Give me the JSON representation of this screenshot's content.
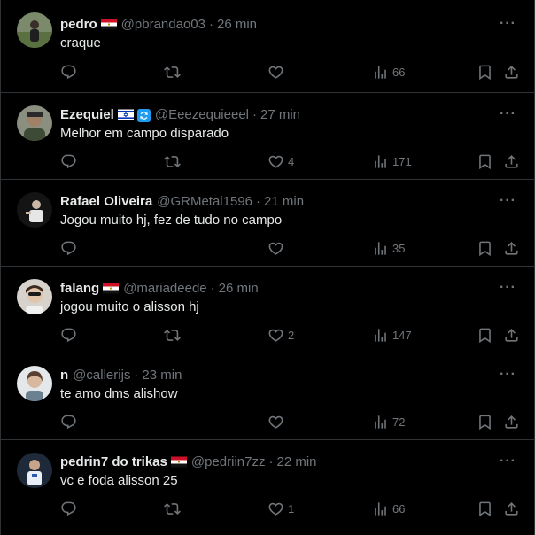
{
  "colors": {
    "background": "#000000",
    "text": "#e7e9ea",
    "muted": "#71767b",
    "divider": "#2f3336"
  },
  "more_label": "···",
  "tweets": [
    {
      "name": "pedro",
      "flag": "egypt-flag-icon",
      "handle": "@pbrandao03",
      "time": "26 min",
      "text": "craque",
      "replies": "",
      "retweets": "",
      "likes": "",
      "views": "66",
      "show_retweet": true
    },
    {
      "name": "Ezequiel",
      "flag": "israel-flag-icon",
      "extra_badge": "repeat-badge-icon",
      "handle": "@Eeezequieeel",
      "time": "27 min",
      "text": "Melhor em campo disparado",
      "replies": "",
      "retweets": "",
      "likes": "4",
      "views": "171",
      "show_retweet": true
    },
    {
      "name": "Rafael Oliveira",
      "handle": "@GRMetal1596",
      "time": "21 min",
      "text": "Jogou muito hj, fez de tudo no campo",
      "replies": "",
      "retweets": "",
      "likes": "",
      "views": "35",
      "show_retweet": false
    },
    {
      "name": "falang",
      "flag": "egypt-flag-icon",
      "handle": "@mariadeede",
      "time": "26 min",
      "text": "jogou muito o alisson hj",
      "replies": "",
      "retweets": "",
      "likes": "2",
      "views": "147",
      "show_retweet": true
    },
    {
      "name": "n",
      "handle": "@callerijs",
      "time": "23 min",
      "text": "te amo dms alishow",
      "replies": "",
      "retweets": "",
      "likes": "",
      "views": "72",
      "show_retweet": false
    },
    {
      "name": "pedrin7 do trikas",
      "flag": "egypt-flag-icon",
      "handle": "@pedriin7zz",
      "time": "22 min",
      "text": "vc e foda alisson 25",
      "replies": "",
      "retweets": "",
      "likes": "1",
      "views": "66",
      "show_retweet": true
    }
  ],
  "separator": "·"
}
